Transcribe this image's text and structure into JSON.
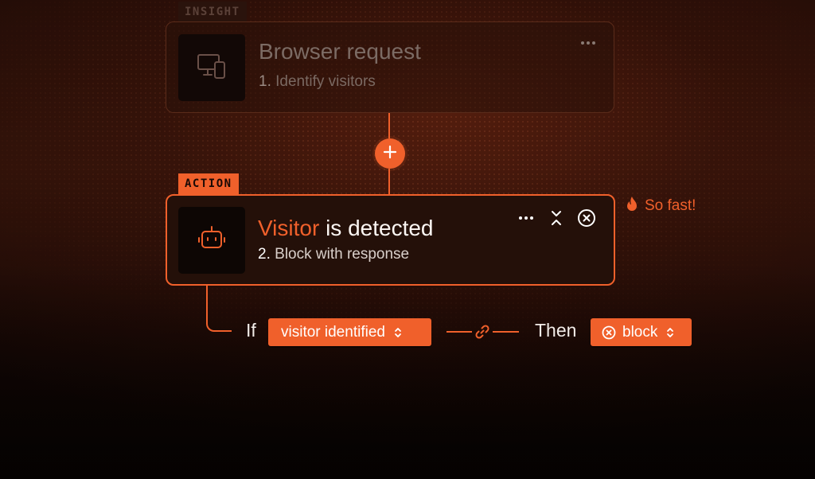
{
  "colors": {
    "accent": "#f0602b",
    "background": "#1a0a06",
    "muted_text": "#7c6b64"
  },
  "insight_step": {
    "tag": "INSIGHT",
    "icon": "devices-icon",
    "title": "Browser request",
    "number": "1.",
    "subtitle": "Identify visitors",
    "menu_icon": "more-horizontal-icon"
  },
  "add_step": {
    "icon": "plus-icon"
  },
  "action_step": {
    "tag": "ACTION",
    "icon": "robot-icon",
    "title_highlight": "Visitor",
    "title_rest": " is detected",
    "number": "2.",
    "subtitle": "Block with response",
    "controls": [
      "more-horizontal-icon",
      "collapse-icon",
      "remove-circle-icon"
    ]
  },
  "badge": {
    "icon": "fire-icon",
    "label": "So fast!"
  },
  "rule": {
    "if_label": "If",
    "condition": "visitor identified",
    "link_icon": "link-icon",
    "then_label": "Then",
    "action_icon": "x-circle-icon",
    "action": "block",
    "chevron_icon": "chevron-up-down-icon"
  }
}
